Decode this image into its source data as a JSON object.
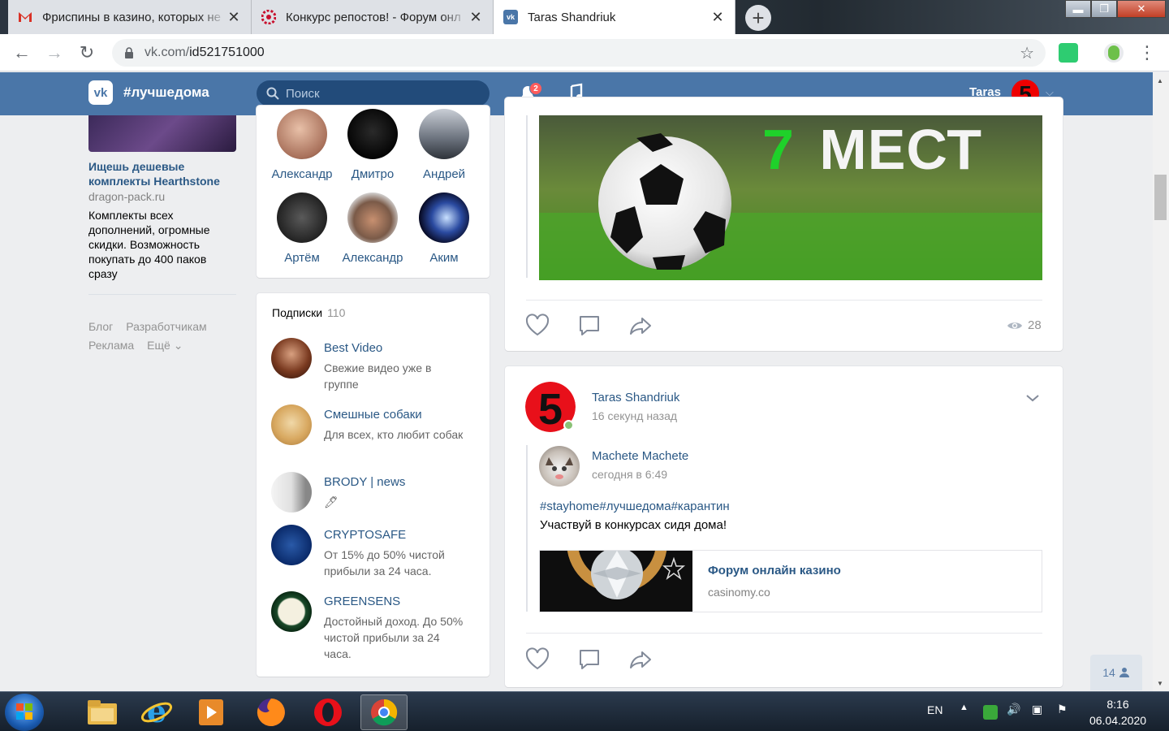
{
  "browser": {
    "tabs": [
      {
        "title": "Фриспины в казино, которых не",
        "close": "✕",
        "favicon": "gmail-icon"
      },
      {
        "title": "Конкурс репостов! - Форум онл",
        "close": "✕",
        "favicon": "forum-icon"
      },
      {
        "title": "Taras Shandriuk",
        "close": "✕",
        "favicon": "vk-icon"
      }
    ],
    "new_tab": "+",
    "window_buttons": {
      "minimize": "▬",
      "maximize": "❐",
      "close": "✕"
    },
    "url_host": "vk.com/",
    "url_path": "id521751000",
    "nav": {
      "back": "←",
      "forward": "→",
      "reload": "↻",
      "bookmark": "☆",
      "menu": "⋮"
    }
  },
  "vk_header": {
    "logo": "vk",
    "brand": "#лучшедома",
    "search_placeholder": "Поиск",
    "notifications_count": "2",
    "user_name": "Taras",
    "chevron": "⌵"
  },
  "ad": {
    "title": "Ищешь дешевые комплекты Hearthstone",
    "site": "dragon-pack.ru",
    "text": "Комплекты всех дополнений, огромные скидки. Возможность покупать до 400 паков сразу"
  },
  "footer_links": [
    "Блог",
    "Разработчикам",
    "Реклама",
    "Ещё ⌄"
  ],
  "friends": [
    {
      "name": "Александр"
    },
    {
      "name": "Дмитро"
    },
    {
      "name": "Андрей"
    },
    {
      "name": "Артём"
    },
    {
      "name": "Александр"
    },
    {
      "name": "Аким"
    }
  ],
  "subscriptions": {
    "heading": "Подписки",
    "count": "110",
    "items": [
      {
        "name": "Best Video",
        "desc": "Свежие видео уже в группе"
      },
      {
        "name": "Смешные собаки",
        "desc": "Для всех, кто любит собак"
      },
      {
        "name": "BRODY | news",
        "desc": "🖊"
      },
      {
        "name": "CRYPTOSAFE",
        "desc": "От 15% до 50% чистой прибыли за 24 часа."
      },
      {
        "name": "GREENSENS",
        "desc": "Достойный доход. До 50% чистой прибыли за 24 часа."
      }
    ]
  },
  "post1": {
    "image_text_number": "7",
    "image_text_word": "МЕСТ",
    "views": "28"
  },
  "post2": {
    "author": "Taras Shandriuk",
    "time": "16 секунд назад",
    "repost_author": "Machete Machete",
    "repost_time": "сегодня в 6:49",
    "tags": "#stayhome#лучшедома#карантин",
    "text": "Участвуй в конкурсах сидя дома!",
    "link_title": "Форум онлайн казино",
    "link_site": "casinomy.co"
  },
  "online_chip": "14",
  "taskbar": {
    "lang": "EN",
    "time": "8:16",
    "date": "06.04.2020"
  },
  "colors": {
    "vk_blue": "#4a76a8",
    "link": "#2a5885",
    "muted": "#939393",
    "page_bg": "#edeef0"
  }
}
